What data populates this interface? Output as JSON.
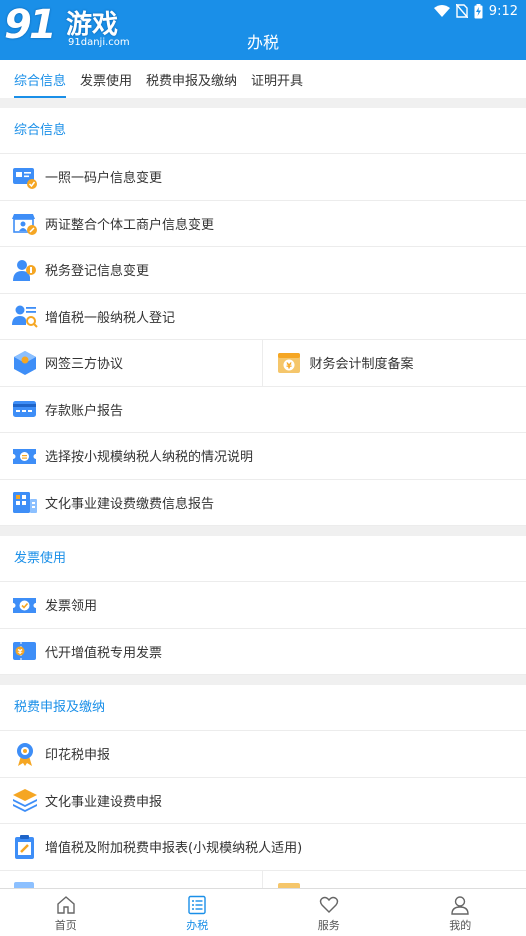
{
  "header": {
    "logo_number": "91",
    "logo_text": "游戏",
    "logo_url": "91danji.com",
    "title": "办税"
  },
  "status_bar": {
    "time": "9:12"
  },
  "tabs": [
    {
      "label": "综合信息",
      "active": true
    },
    {
      "label": "发票使用",
      "active": false
    },
    {
      "label": "税费申报及缴纳",
      "active": false
    },
    {
      "label": "证明开具",
      "active": false
    }
  ],
  "sections": [
    {
      "title": "综合信息",
      "items": [
        {
          "label": "一照一码户信息变更",
          "icon": "id-card-icon"
        },
        {
          "label": "两证整合个体工商户信息变更",
          "icon": "shop-icon"
        },
        {
          "label": "税务登记信息变更",
          "icon": "person-tag-icon"
        },
        {
          "label": "增值税一般纳税人登记",
          "icon": "person-search-icon"
        },
        {
          "label": "网签三方协议",
          "icon": "cube-icon"
        },
        {
          "label": "财务会计制度备案",
          "icon": "yuan-window-icon"
        },
        {
          "label": "存款账户报告",
          "icon": "bank-card-icon"
        },
        {
          "label": "选择按小规模纳税人纳税的情况说明",
          "icon": "ticket-icon"
        },
        {
          "label": "文化事业建设费缴费信息报告",
          "icon": "building-icon"
        }
      ]
    },
    {
      "title": "发票使用",
      "items": [
        {
          "label": "发票领用",
          "icon": "invoice-check-icon"
        },
        {
          "label": "代开增值税专用发票",
          "icon": "invoice-yuan-icon"
        }
      ]
    },
    {
      "title": "税费申报及缴纳",
      "items": [
        {
          "label": "印花税申报",
          "icon": "stamp-medal-icon"
        },
        {
          "label": "文化事业建设费申报",
          "icon": "layers-icon"
        },
        {
          "label": "增值税及附加税费申报表(小规模纳税人适用)",
          "icon": "clipboard-icon"
        }
      ]
    }
  ],
  "bottom_nav": [
    {
      "label": "首页",
      "icon": "home-icon",
      "active": false
    },
    {
      "label": "办税",
      "icon": "list-icon",
      "active": true
    },
    {
      "label": "服务",
      "icon": "heart-icon",
      "active": false
    },
    {
      "label": "我的",
      "icon": "user-icon",
      "active": false
    }
  ],
  "colors": {
    "primary": "#1a8fe8",
    "icon_blue": "#3e8ef7",
    "icon_orange": "#f5a623"
  }
}
